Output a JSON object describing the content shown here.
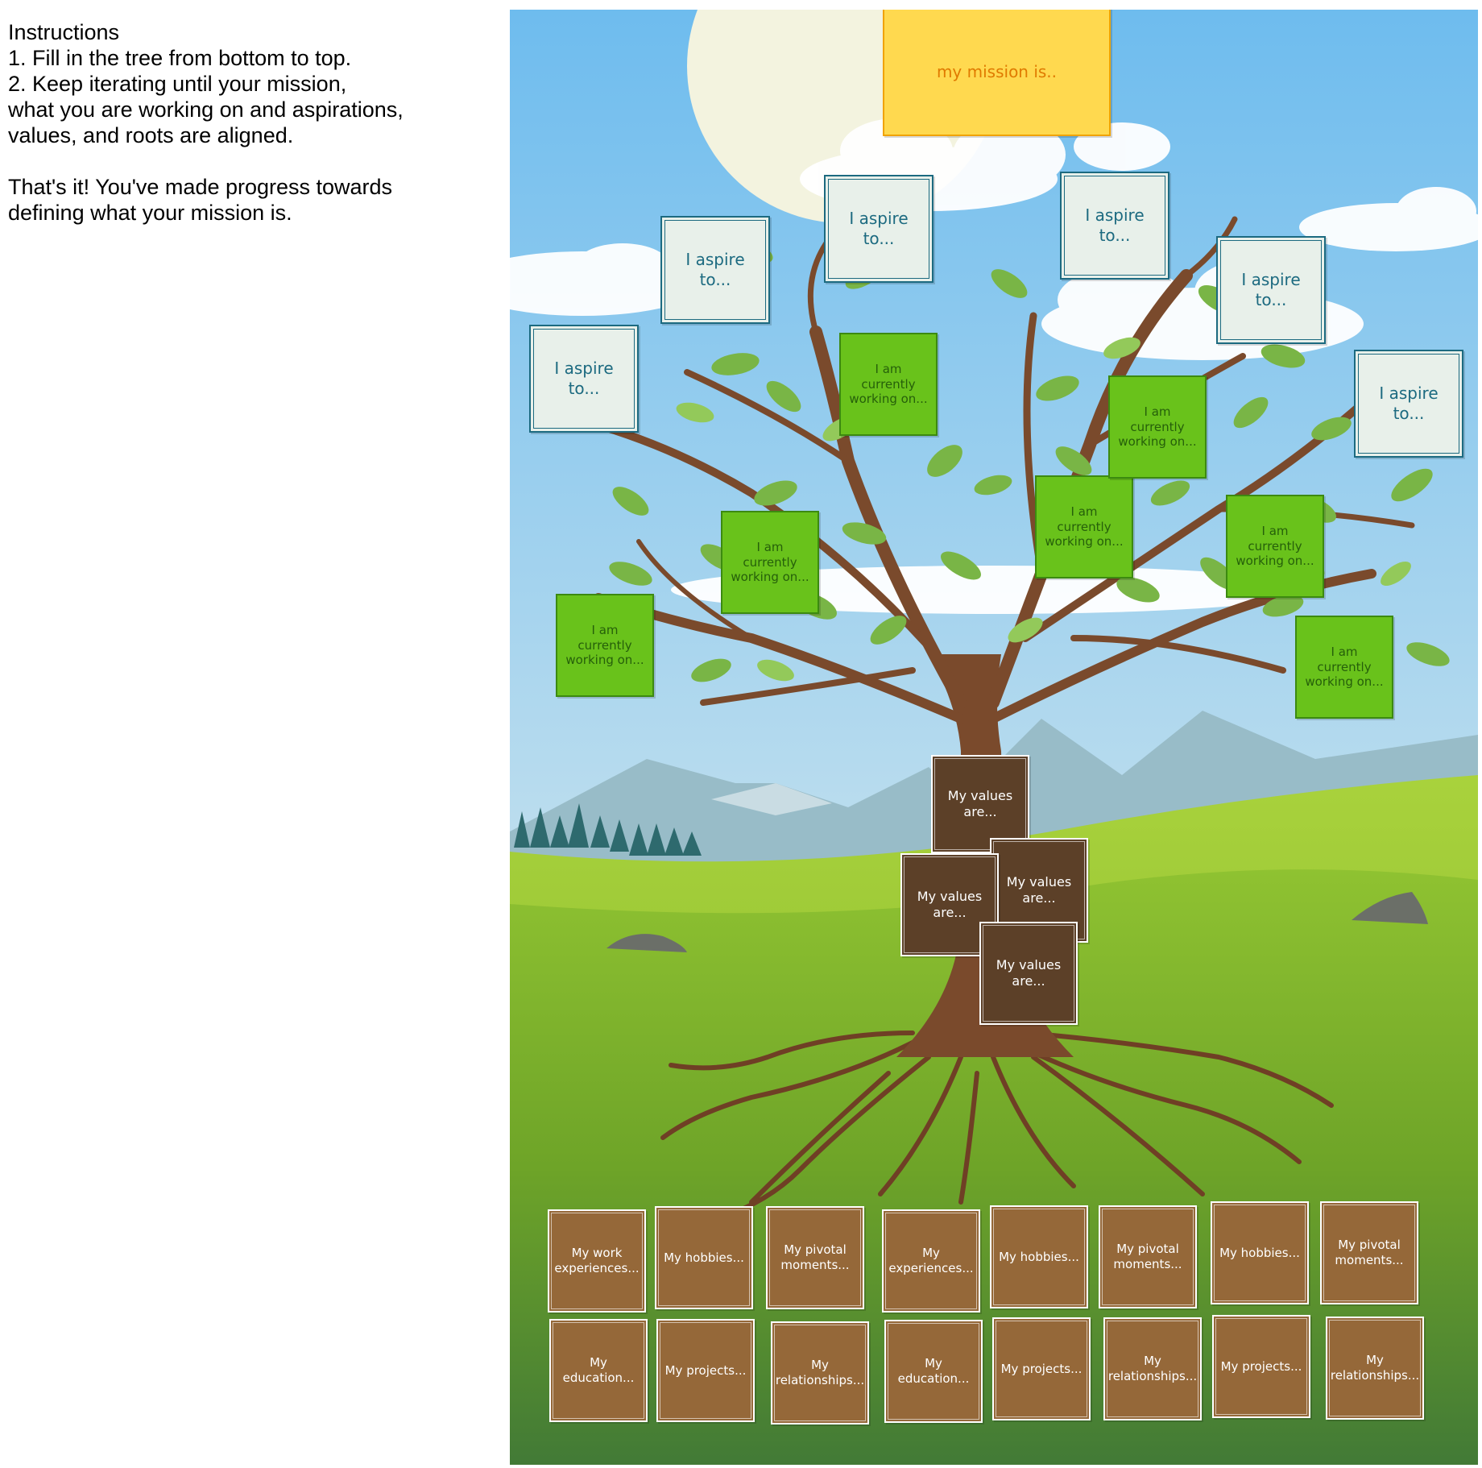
{
  "instructions": {
    "lines": [
      "Instructions",
      "1. Fill in the tree from bottom to top.",
      "2. Keep iterating until your mission,",
      "what you are working on and aspirations,",
      "values, and roots are aligned.",
      "",
      "That's it! You've made progress towards",
      "defining what your mission is."
    ]
  },
  "mission": {
    "label": "my mission is.."
  },
  "aspirations": [
    "I aspire to...",
    "I aspire to...",
    "I aspire to...",
    "I aspire to...",
    "I aspire to...",
    "I aspire to..."
  ],
  "working": [
    "I am currently working on...",
    "I am currently working on...",
    "I am currently working on...",
    "I am currently working on...",
    "I am currently working on...",
    "I am currently working on...",
    "I am currently working on..."
  ],
  "values": [
    "My values are...",
    "My values are...",
    "My values are...",
    "My values are..."
  ],
  "roots": [
    "My work experiences...",
    "My hobbies...",
    "My pivotal moments...",
    "My experiences...",
    "My hobbies...",
    "My pivotal moments...",
    "My hobbies...",
    "My pivotal moments...",
    "My education...",
    "My projects...",
    "My relationships...",
    "My education...",
    "My projects...",
    "My relationships...",
    "My projects...",
    "My relationships..."
  ],
  "colors": {
    "sky_top": "#7cc2ee",
    "sky_bottom": "#e8f1e6",
    "grass": "#7fb428",
    "trunk": "#7a4a2c",
    "leaf": "#79b546",
    "mission_note": "#ffd94f",
    "aspire_note": "#e8f0ea",
    "working_note": "#69c21b",
    "values_note": "#5c4028",
    "roots_note": "#956839"
  }
}
